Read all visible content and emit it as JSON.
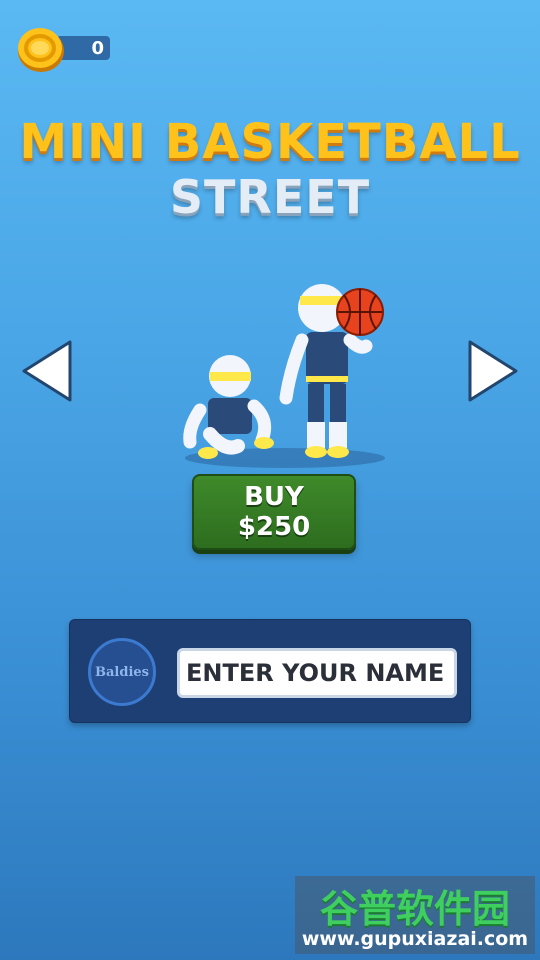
{
  "hud": {
    "coins": "0"
  },
  "title": {
    "line1": "MINI BASKETBALL",
    "line2": "STREET"
  },
  "shop": {
    "buy_label": "BUY",
    "price": "$250"
  },
  "profile": {
    "badge_text": "Baldies",
    "name_placeholder": "ENTER YOUR NAME"
  },
  "watermark": {
    "cn_text": "谷普软件园",
    "url": "www.gupuxiazai.com"
  },
  "colors": {
    "title_gold": "#ffc21a",
    "buy_green": "#3f8a2a",
    "panel_navy": "#1e3f74",
    "jersey": "#2a4a7a",
    "accent_yellow": "#ffe94a"
  },
  "icons": [
    "coin-icon",
    "arrow-left-icon",
    "arrow-right-icon",
    "basketball-icon"
  ]
}
